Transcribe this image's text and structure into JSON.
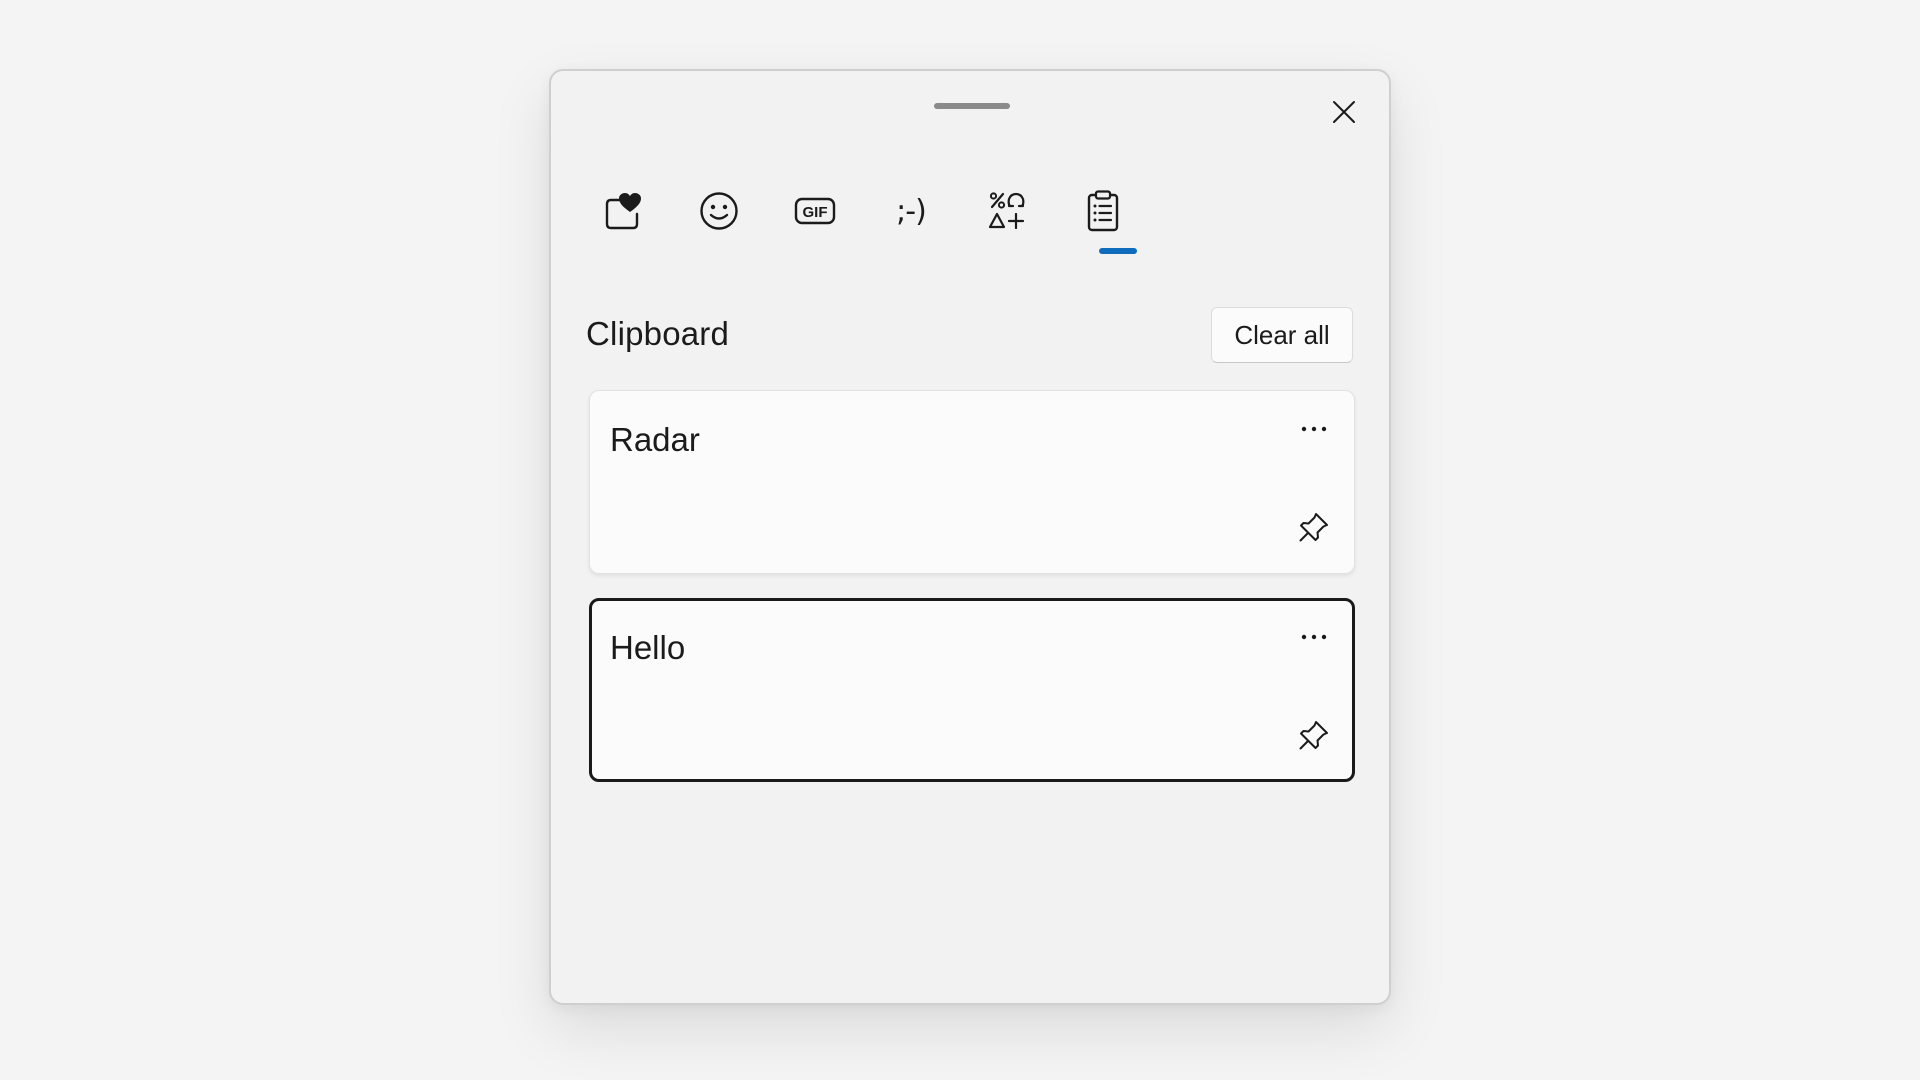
{
  "panel": {
    "active_tab": "clipboard"
  },
  "tabs": [
    {
      "id": "favorites",
      "icon": "heart-sticker-icon",
      "label": ""
    },
    {
      "id": "emoji",
      "icon": "smiley-icon",
      "label": ""
    },
    {
      "id": "gif",
      "icon": "gif-icon",
      "label": "GIF"
    },
    {
      "id": "kaomoji",
      "icon": "kaomoji-icon",
      "label": ";-)"
    },
    {
      "id": "symbols",
      "icon": "symbols-icon",
      "label": ""
    },
    {
      "id": "clipboard",
      "icon": "clipboard-icon",
      "label": ""
    }
  ],
  "clipboard": {
    "title": "Clipboard",
    "clear_all_label": "Clear all",
    "items": [
      {
        "text": "Radar",
        "more_label": "···",
        "focused": false
      },
      {
        "text": "Hello",
        "more_label": "···",
        "focused": true
      }
    ]
  },
  "colors": {
    "accent": "#0f6cbd",
    "panel_bg": "#f2f2f2",
    "card_bg": "#fbfbfb"
  }
}
